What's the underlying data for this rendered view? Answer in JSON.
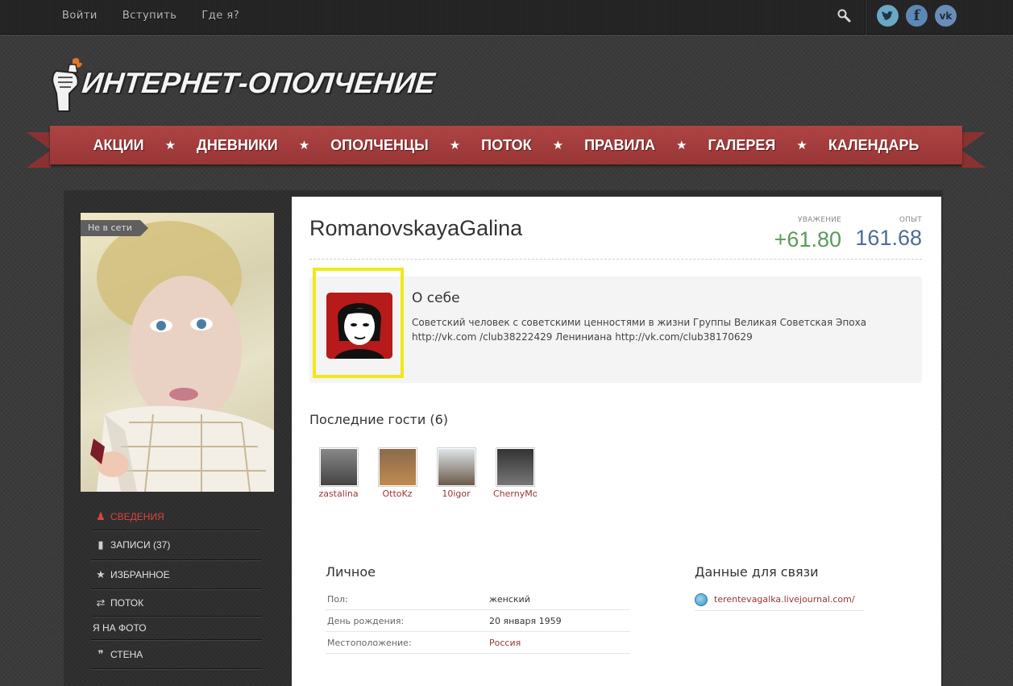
{
  "topnav": {
    "login": "Войти",
    "join": "Вступить",
    "where": "Где я?"
  },
  "social": {
    "twitter": "t",
    "facebook": "f",
    "vk": "vk"
  },
  "logo": {
    "text": "ИНТЕРНЕТ-ОПОЛЧЕНИЕ"
  },
  "mainnav": {
    "items": [
      "АКЦИИ",
      "ДНЕВНИКИ",
      "ОПОЛЧЕНЦЫ",
      "ПОТОК",
      "ПРАВИЛА",
      "ГАЛЕРЕЯ",
      "КАЛЕНДАРЬ"
    ],
    "separator": "★"
  },
  "profile": {
    "status": "Не в сети",
    "username": "RomanovskayaGalina",
    "respect_label": "УВАЖЕНИЕ",
    "respect_value": "+61.80",
    "experience_label": "ОПЫТ",
    "experience_value": "161.68"
  },
  "sidebar": {
    "items": [
      {
        "label": "СВЕДЕНИЯ",
        "icon": "user-icon",
        "glyph": "♟"
      },
      {
        "label": "ЗАПИСИ (37)",
        "icon": "mouse-icon",
        "glyph": "▮"
      },
      {
        "label": "ИЗБРАННОЕ",
        "icon": "star-icon",
        "glyph": "★"
      },
      {
        "label": "ПОТОК",
        "icon": "retweet-icon",
        "glyph": "⇄"
      },
      {
        "label": "Я НА ФОТО",
        "icon": "",
        "glyph": ""
      },
      {
        "label": "СТЕНА",
        "icon": "quote-icon",
        "glyph": "❞"
      }
    ]
  },
  "about": {
    "title": "О себе",
    "text": "Советский человек с советскими ценностями в жизни Группы Великая Советская Эпоха http://vk.com /club38222429 Лениниана http://vk.com/club38170629"
  },
  "guests": {
    "title": "Последние гости (6)",
    "list": [
      "zastalina",
      "OttoKz",
      "10igor",
      "ChernyMo"
    ]
  },
  "personal": {
    "title": "Личное",
    "rows": [
      {
        "key": "Пол:",
        "value": "женский"
      },
      {
        "key": "День рождения:",
        "value": "20 января 1959"
      },
      {
        "key": "Местоположение:",
        "value": "Россия"
      }
    ]
  },
  "contacts": {
    "title": "Данные для связи",
    "link": "terentevagalka.livejournal.com/"
  },
  "colors": {
    "accent": "#a33d3d",
    "respect": "#5a9a5a",
    "experience": "#4f6c94",
    "highlight": "#f0e81a"
  }
}
